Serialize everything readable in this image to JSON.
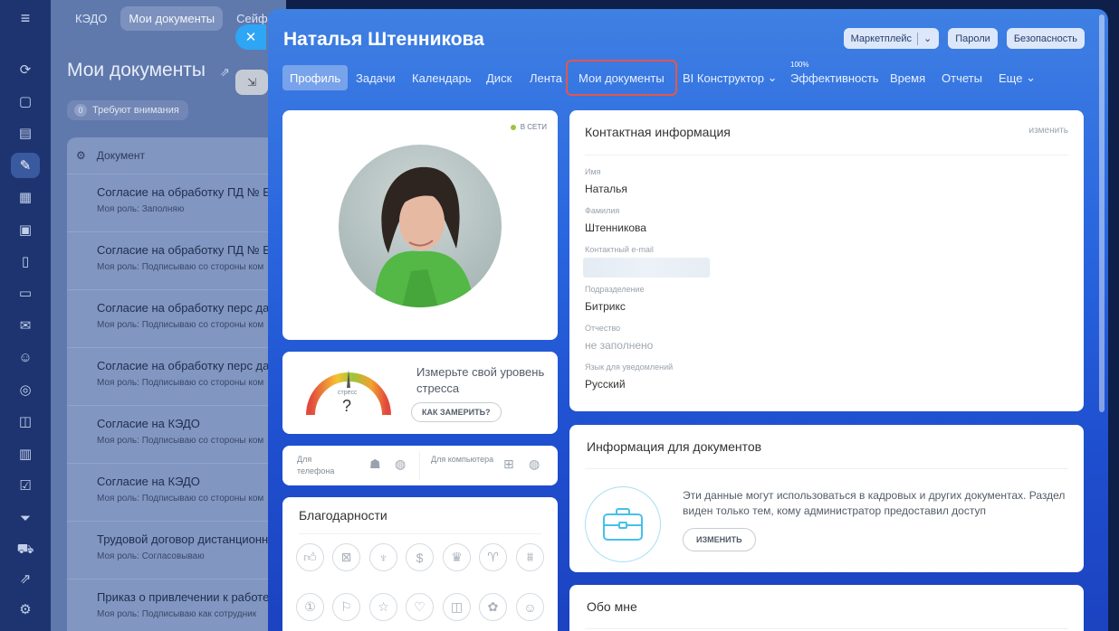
{
  "background_page": {
    "tabs": [
      "КЭДО",
      "Мои документы",
      "Сейф ко"
    ],
    "title": "Мои документы",
    "attention_count": "0",
    "attention_label": "Требуют внимания",
    "grid_header": "Документ",
    "rows": [
      {
        "title": "Согласие на обработку ПД № Б/",
        "role": "Моя роль: Заполняю"
      },
      {
        "title": "Согласие на обработку ПД № Б/",
        "role": "Моя роль: Подписываю со стороны ком"
      },
      {
        "title": "Согласие на обработку перс дан",
        "role": "Моя роль: Подписываю со стороны ком"
      },
      {
        "title": "Согласие на обработку перс дан",
        "role": "Моя роль: Подписываю со стороны ком"
      },
      {
        "title": "Согласие на КЭДО",
        "role": "Моя роль: Подписываю со стороны ком"
      },
      {
        "title": "Согласие на КЭДО",
        "role": "Моя роль: Подписываю со стороны ком"
      },
      {
        "title": "Трудовой договор дистанционн",
        "role": "Моя роль: Согласовываю"
      },
      {
        "title": "Приказ о привлечении к работе",
        "role": "Моя роль: Подписываю как сотрудник"
      }
    ]
  },
  "profile": {
    "name": "Наталья Штенникова",
    "top_buttons": {
      "marketplace": "Маркетплейс",
      "passwords": "Пароли",
      "security": "Безопасность"
    },
    "nav": [
      "Профиль",
      "Задачи",
      "Календарь",
      "Диск",
      "Лента",
      "Мои документы",
      "BI Конструктор",
      "Эффективность",
      "Время",
      "Отчеты",
      "Еще"
    ],
    "efficiency_percent": "100%",
    "online_status": "В СЕТИ",
    "stress": {
      "gauge_label": "стресс",
      "gauge_value": "?",
      "text": "Измерьте свой уровень стресса",
      "button": "КАК ЗАМЕРИТЬ?"
    },
    "apps": {
      "phone_label": "Для телефона",
      "computer_label": "Для компьютера"
    },
    "thanks_title": "Благодарности",
    "contact": {
      "title": "Контактная информация",
      "edit": "изменить",
      "first_name_label": "Имя",
      "first_name": "Наталья",
      "last_name_label": "Фамилия",
      "last_name": "Штенникова",
      "email_label": "Контактный e-mail",
      "department_label": "Подразделение",
      "department": "Битрикс",
      "patronymic_label": "Отчество",
      "patronymic": "не заполнено",
      "language_label": "Язык для уведомлений",
      "language": "Русский"
    },
    "doc_info": {
      "title": "Информация для документов",
      "text": "Эти данные могут использоваться в кадровых и других документах. Раздел виден только тем, кому администратор предоставил доступ",
      "button": "ИЗМЕНИТЬ"
    },
    "about_title": "Обо мне"
  },
  "colors": {
    "highlight": "#e2574c",
    "online": "#9bc53d"
  }
}
